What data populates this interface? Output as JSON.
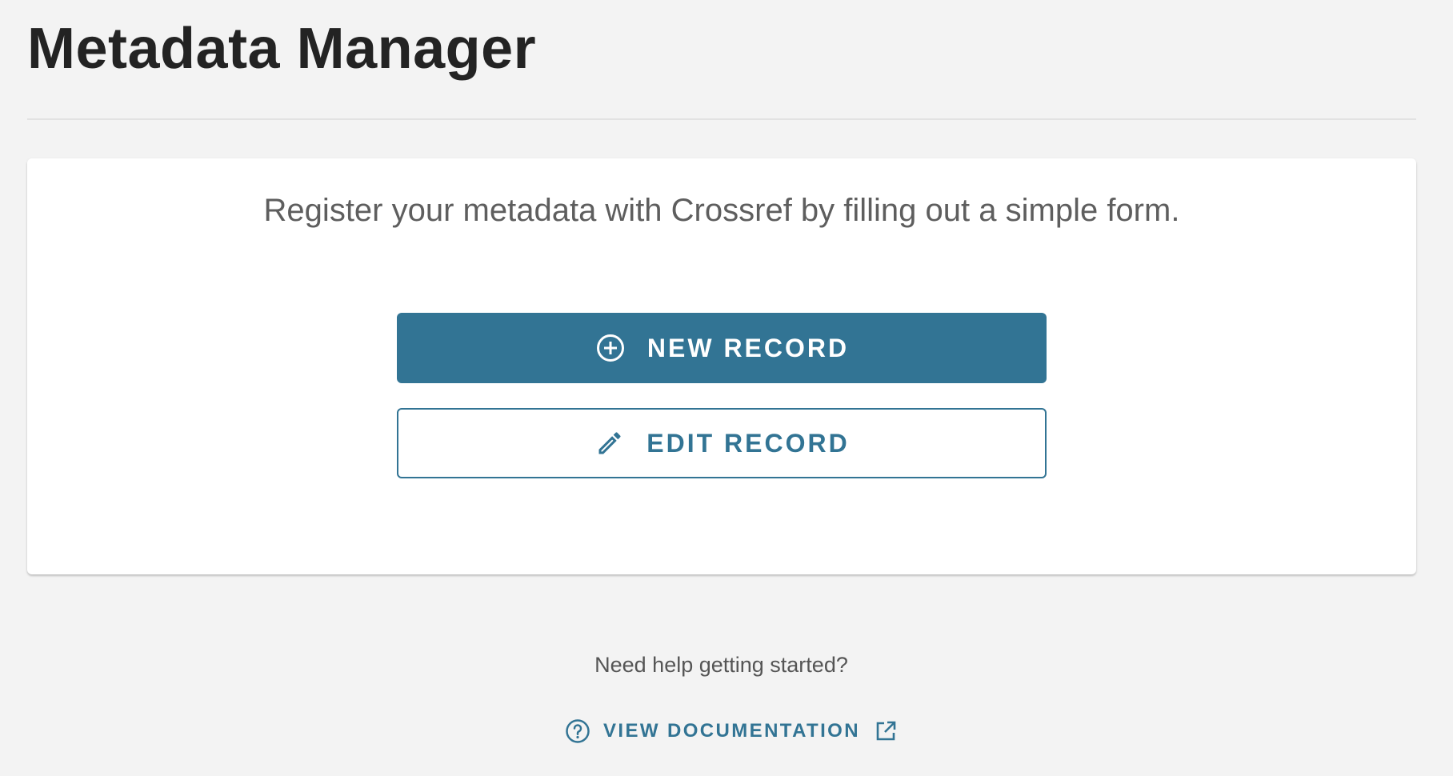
{
  "header": {
    "title": "Metadata Manager"
  },
  "card": {
    "subtitle": "Register your metadata with Crossref by filling out a simple form.",
    "new_record": {
      "label": "NEW RECORD",
      "icon": "plus-circle-icon"
    },
    "edit_record": {
      "label": "EDIT RECORD",
      "icon": "pencil-icon"
    }
  },
  "help": {
    "prompt": "Need help getting started?",
    "link_label": "VIEW DOCUMENTATION",
    "link_icon": "help-circle-icon",
    "external_icon": "external-link-icon"
  },
  "colors": {
    "primary": "#327494",
    "background": "#f3f3f3",
    "card": "#ffffff",
    "title": "#232323",
    "subtitle": "#5e5e5e"
  }
}
